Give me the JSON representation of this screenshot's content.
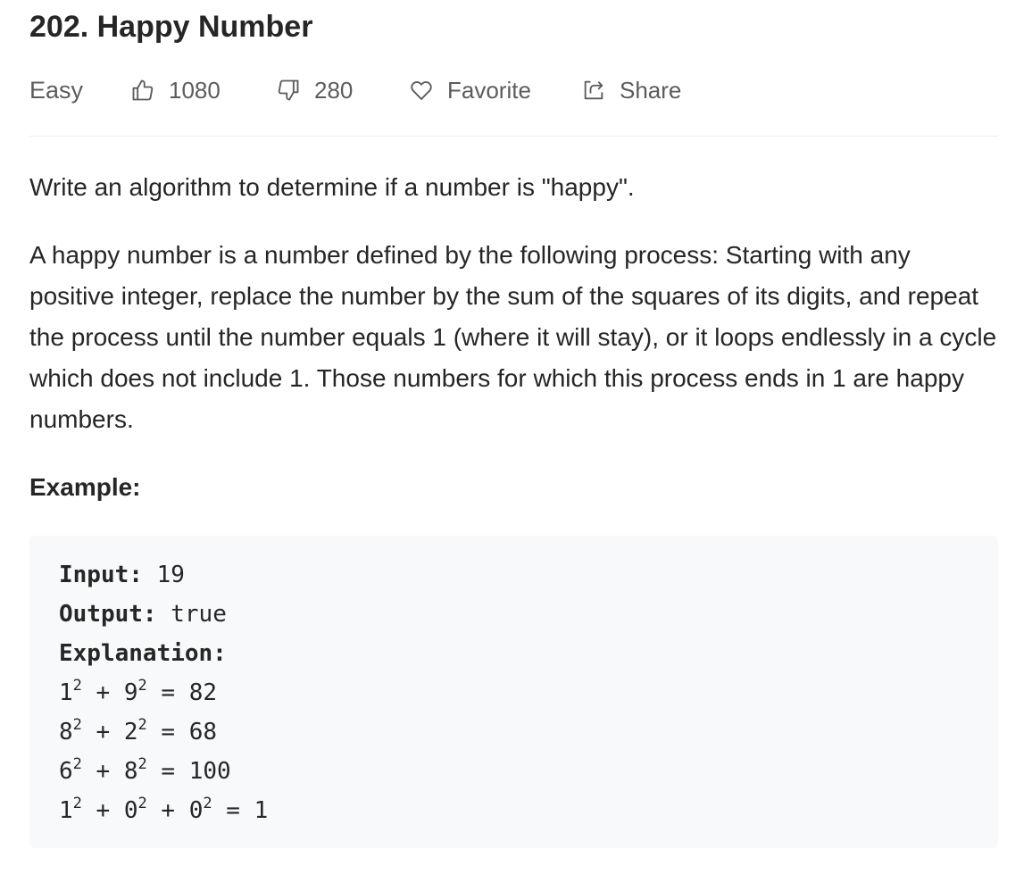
{
  "problem": {
    "title": "202. Happy Number",
    "difficulty": "Easy",
    "likes": "1080",
    "dislikes": "280",
    "favorite_label": "Favorite",
    "share_label": "Share"
  },
  "description": {
    "intro": "Write an algorithm to determine if a number is \"happy\".",
    "definition": "A happy number is a number defined by the following process: Starting with any positive integer, replace the number by the sum of the squares of its digits, and repeat the process until the number equals 1 (where it will stay), or it loops endlessly in a cycle which does not include 1. Those numbers for which this process ends in 1 are happy numbers."
  },
  "example": {
    "heading": "Example:",
    "input_label": "Input:",
    "input_value": "19",
    "output_label": "Output:",
    "output_value": "true",
    "explanation_label": "Explanation:",
    "lines": [
      {
        "terms": [
          "1",
          "9"
        ],
        "result": "82"
      },
      {
        "terms": [
          "8",
          "2"
        ],
        "result": "68"
      },
      {
        "terms": [
          "6",
          "8"
        ],
        "result": "100"
      },
      {
        "terms": [
          "1",
          "0",
          "0"
        ],
        "result": "1"
      }
    ],
    "exponent": "2"
  },
  "icons": {
    "likes": "thumbs-up-icon",
    "dislikes": "thumbs-down-icon",
    "favorite": "heart-icon",
    "share": "share-icon"
  },
  "colors": {
    "text": "#262626",
    "meta_text": "#5c5c5c",
    "code_background": "#f7f9fa"
  }
}
